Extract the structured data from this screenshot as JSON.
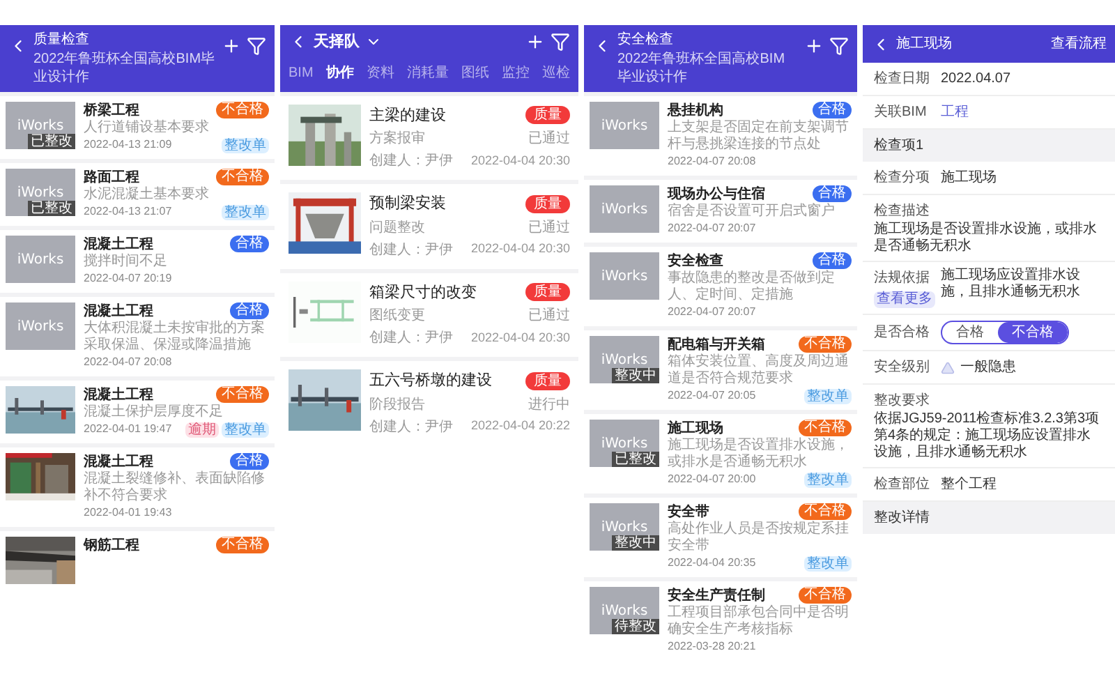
{
  "quality_screen": {
    "title": "质量检查",
    "subtitle": "2022年鲁班杯全国高校BIM毕业设计作",
    "items": [
      {
        "thumb": {
          "kind": "placeholder",
          "text": "iWorks",
          "tag": "已整改"
        },
        "title": "桥梁工程",
        "description": "人行道铺设基本要求",
        "time": "2022-04-13 21:09",
        "result": {
          "label": "不合格",
          "kind": "fail"
        },
        "chips": [
          {
            "label": "整改单",
            "kind": "order"
          }
        ]
      },
      {
        "thumb": {
          "kind": "placeholder",
          "text": "iWorks",
          "tag": "已整改"
        },
        "title": "路面工程",
        "description": "水泥混凝土基本要求",
        "time": "2022-04-13 21:07",
        "result": {
          "label": "不合格",
          "kind": "fail"
        },
        "chips": [
          {
            "label": "整改单",
            "kind": "order"
          }
        ]
      },
      {
        "thumb": {
          "kind": "placeholder",
          "text": "iWorks"
        },
        "title": "混凝土工程",
        "description": "搅拌时间不足",
        "time": "2022-04-07 20:19",
        "result": {
          "label": "合格",
          "kind": "pass"
        }
      },
      {
        "thumb": {
          "kind": "placeholder",
          "text": "iWorks"
        },
        "title": "混凝土工程",
        "description": "大体积混凝土未按审批的方案采取保温、保湿或降温措施",
        "time": "2022-04-07 20:08",
        "result": {
          "label": "合格",
          "kind": "pass"
        }
      },
      {
        "title": "混凝土工程",
        "description": "混凝土保护层厚度不足",
        "time": "2022-04-01 19:47",
        "result": {
          "label": "不合格",
          "kind": "fail"
        },
        "chips": [
          {
            "label": "逾期",
            "kind": "overdue"
          },
          {
            "label": "整改单",
            "kind": "order"
          }
        ]
      },
      {
        "title": "混凝土工程",
        "description": "混凝土裂缝修补、表面缺陷修补不符合要求",
        "time": "2022-04-01 19:43",
        "result": {
          "label": "合格",
          "kind": "pass"
        }
      },
      {
        "title": "钢筋工程",
        "result": {
          "label": "不合格",
          "kind": "fail"
        }
      }
    ]
  },
  "collab_screen": {
    "title": "天择队",
    "tabs": [
      {
        "label": "BIM",
        "selected": false
      },
      {
        "label": "协作",
        "selected": true
      },
      {
        "label": "资料",
        "selected": false
      },
      {
        "label": "消耗量",
        "selected": false
      },
      {
        "label": "图纸",
        "selected": false
      },
      {
        "label": "监控",
        "selected": false
      },
      {
        "label": "巡检",
        "selected": false
      }
    ],
    "items": [
      {
        "title": "主梁的建设",
        "badge": "质量",
        "type": "方案报审",
        "status": "已通过",
        "creator": "创建人：尹伊",
        "time": "2022-04-04 20:30"
      },
      {
        "title": "预制梁安装",
        "badge": "质量",
        "type": "问题整改",
        "status": "已通过",
        "creator": "创建人：尹伊",
        "time": "2022-04-04 20:30"
      },
      {
        "title": "箱梁尺寸的改变",
        "badge": "质量",
        "type": "图纸变更",
        "status": "已通过",
        "creator": "创建人：尹伊",
        "time": "2022-04-04 20:30"
      },
      {
        "title": "五六号桥墩的建设",
        "badge": "质量",
        "type": "阶段报告",
        "status": "进行中",
        "creator": "创建人：尹伊",
        "time": "2022-04-04 20:22"
      }
    ]
  },
  "safety_screen": {
    "title": "安全检查",
    "subtitle": "2022年鲁班杯全国高校BIM毕业设计作",
    "items": [
      {
        "thumb": {
          "kind": "placeholder",
          "text": "iWorks"
        },
        "title": "悬挂机构",
        "description": "上支架是否固定在前支架调节杆与悬挑梁连接的节点处",
        "time": "2022-04-07 20:08",
        "result": {
          "label": "合格",
          "kind": "pass"
        }
      },
      {
        "thumb": {
          "kind": "placeholder",
          "text": "iWorks"
        },
        "title": "现场办公与住宿",
        "description": "宿舍是否设置可开启式窗户",
        "time": "2022-04-07 20:07",
        "result": {
          "label": "合格",
          "kind": "pass"
        }
      },
      {
        "thumb": {
          "kind": "placeholder",
          "text": "iWorks"
        },
        "title": "安全检查",
        "description": "事故隐患的整改是否做到定人、定时间、定措施",
        "time": "2022-04-07 20:07",
        "result": {
          "label": "合格",
          "kind": "pass"
        }
      },
      {
        "thumb": {
          "kind": "placeholder",
          "text": "iWorks",
          "tag": "整改中"
        },
        "title": "配电箱与开关箱",
        "description": "箱体安装位置、高度及周边通道是否符合规范要求",
        "time": "2022-04-07 20:05",
        "result": {
          "label": "不合格",
          "kind": "fail"
        },
        "chips": [
          {
            "label": "整改单",
            "kind": "order"
          }
        ]
      },
      {
        "thumb": {
          "kind": "placeholder",
          "text": "iWorks",
          "tag": "已整改"
        },
        "title": "施工现场",
        "description": "施工现场是否设置排水设施，或排水是否通畅无积水",
        "time": "2022-04-07 20:00",
        "result": {
          "label": "不合格",
          "kind": "fail"
        },
        "chips": [
          {
            "label": "整改单",
            "kind": "order"
          }
        ]
      },
      {
        "thumb": {
          "kind": "placeholder",
          "text": "iWorks",
          "tag": "整改中"
        },
        "title": "安全带",
        "description": "高处作业人员是否按规定系挂安全带",
        "time": "2022-04-04 20:35",
        "result": {
          "label": "不合格",
          "kind": "fail"
        },
        "chips": [
          {
            "label": "整改单",
            "kind": "order"
          }
        ]
      },
      {
        "thumb": {
          "kind": "placeholder",
          "text": "iWorks",
          "tag": "待整改"
        },
        "title": "安全生产责任制",
        "description": "工程项目部承包合同中是否明确安全生产考核指标",
        "time": "2022-03-28 20:21",
        "result": {
          "label": "不合格",
          "kind": "fail"
        }
      }
    ]
  },
  "detail_screen": {
    "title": "施工现场",
    "action": "查看流程",
    "rows": [
      {
        "kind": "field",
        "label": "检查日期",
        "value": "2022.04.07"
      },
      {
        "kind": "link",
        "label": "关联BIM",
        "value": "工程"
      },
      {
        "kind": "section",
        "label": "检查项1"
      },
      {
        "kind": "field",
        "label": "检查分项",
        "value": "施工现场"
      },
      {
        "kind": "label",
        "label": "检查描述"
      },
      {
        "kind": "paragraph",
        "value": "施工现场是否设置排水设施，或排水是否通畅无积水"
      },
      {
        "kind": "law",
        "label": "法规依据",
        "more": "查看更多",
        "value": "施工现场应设置排水设施，且排水通畅无积水"
      },
      {
        "kind": "toggle",
        "label": "是否合格",
        "options": [
          {
            "label": "合格",
            "selected": false
          },
          {
            "label": "不合格",
            "selected": true
          }
        ]
      },
      {
        "kind": "level",
        "label": "安全级别",
        "value": "一般隐患"
      },
      {
        "kind": "label",
        "label": "整改要求"
      },
      {
        "kind": "paragraph",
        "value": "依据JGJ59-2011检查标准3.2.3第3项第4条的规定：施工现场应设置排水设施，且排水通畅无积水"
      },
      {
        "kind": "field",
        "label": "检查部位",
        "value": "整个工程"
      },
      {
        "kind": "section",
        "label": "整改详情"
      }
    ]
  }
}
